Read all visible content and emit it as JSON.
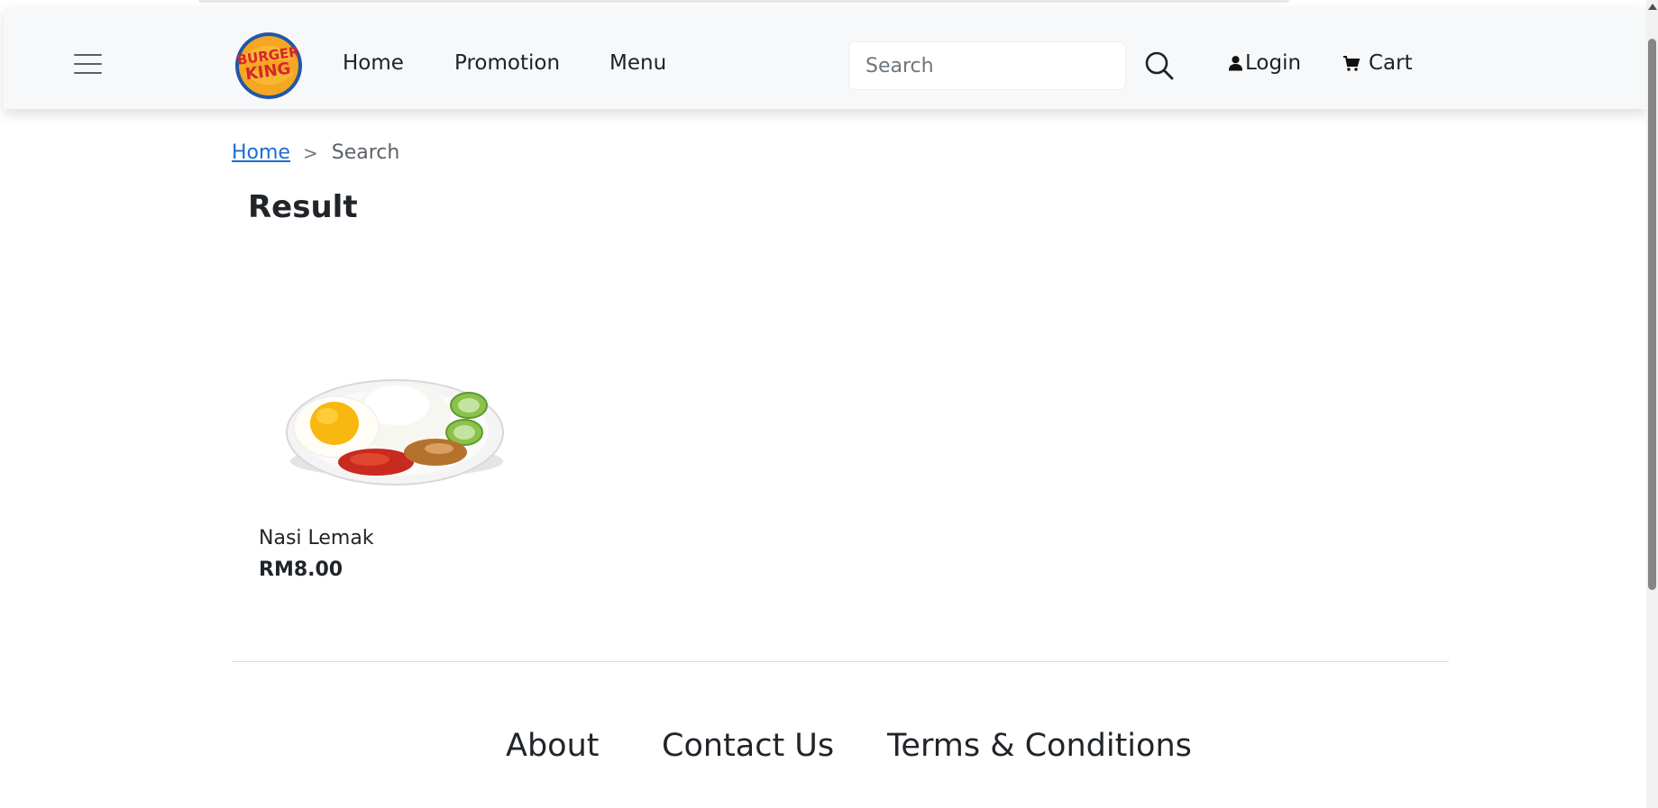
{
  "header": {
    "menu_icon": "hamburger-menu-icon",
    "logo_text_top": "BURGER",
    "logo_text_bottom": "KING",
    "nav": [
      "Home",
      "Promotion",
      "Menu"
    ],
    "search_placeholder": "Search",
    "search_icon": "search-icon",
    "login_label": "Login",
    "cart_label": "Cart"
  },
  "breadcrumb": {
    "home": "Home",
    "separator": ">",
    "current": "Search"
  },
  "page": {
    "title": "Result"
  },
  "results": [
    {
      "name": "Nasi Lemak",
      "price": "RM8.00",
      "image": "nasi-lemak-plate"
    }
  ],
  "footer": {
    "links": [
      "About",
      "Contact Us",
      "Terms & Conditions"
    ]
  },
  "colors": {
    "link": "#1a6dd1",
    "header_bg": "#f7f8f9",
    "text": "#212529"
  }
}
